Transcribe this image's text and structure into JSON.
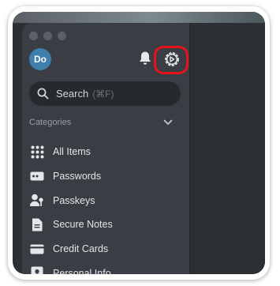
{
  "account": {
    "avatar_initials": "Do"
  },
  "search": {
    "label": "Search",
    "shortcut": "(⌘F)"
  },
  "categories": {
    "header": "Categories",
    "items": [
      {
        "label": "All Items",
        "icon": "grid-icon"
      },
      {
        "label": "Passwords",
        "icon": "password-icon"
      },
      {
        "label": "Passkeys",
        "icon": "passkey-icon"
      },
      {
        "label": "Secure Notes",
        "icon": "note-icon"
      },
      {
        "label": "Credit Cards",
        "icon": "credit-card-icon"
      },
      {
        "label": "Personal Info",
        "icon": "personal-info-icon"
      }
    ]
  },
  "colors": {
    "sidebar": "#3a3d43",
    "highlight_ring": "#e5141c",
    "avatar": "#3f7fae"
  }
}
